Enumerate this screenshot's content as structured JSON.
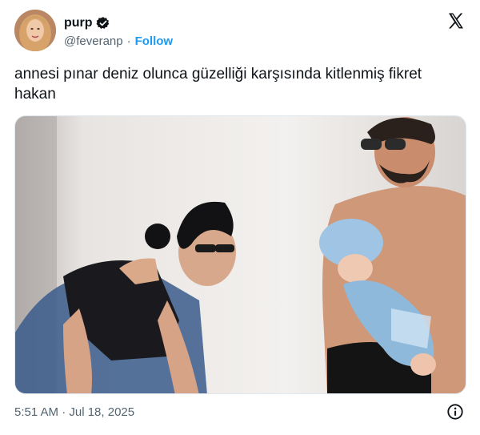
{
  "user": {
    "display_name": "purp",
    "handle": "@feveranp",
    "follow_label": "Follow",
    "separator": "·"
  },
  "tweet": {
    "text": "annesi pınar deniz olunca güzelliği karşısında kitlenmiş fikret hakan"
  },
  "footer": {
    "timestamp": "5:51 AM · Jul 18, 2025"
  },
  "icons": {
    "verified": "verified-badge-icon",
    "logo": "x-logo-icon",
    "info": "info-icon"
  },
  "colors": {
    "text": "#0f1419",
    "secondary": "#536471",
    "follow": "#1d9bf0"
  }
}
